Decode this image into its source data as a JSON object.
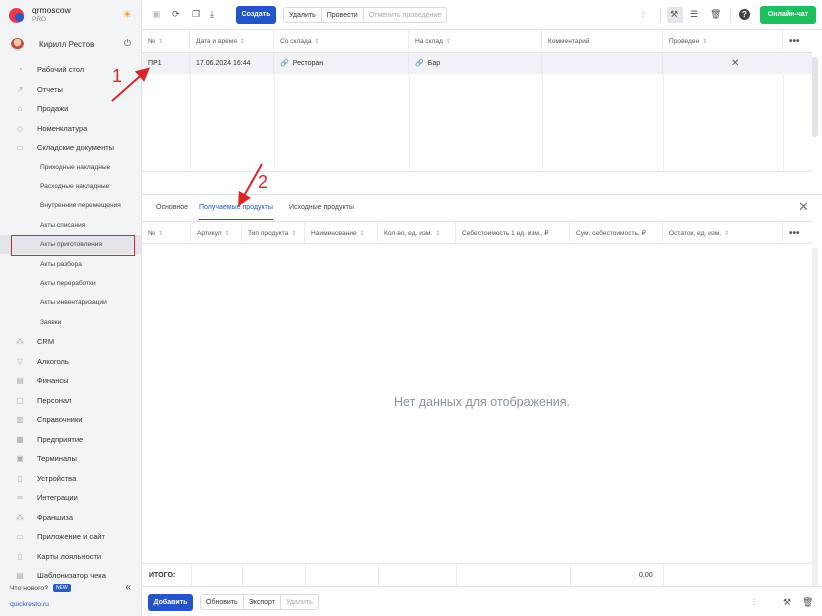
{
  "brand": {
    "name": "qrmoscow",
    "plan": "PRO"
  },
  "user": {
    "name": "Кирилл Рестов"
  },
  "nav": {
    "items_top": [
      {
        "label": "Рабочий стол",
        "icon": "dashboard-icon"
      },
      {
        "label": "Отчеты",
        "icon": "reports-icon"
      },
      {
        "label": "Продажи",
        "icon": "sales-icon"
      },
      {
        "label": "Номенклатура",
        "icon": "nomenclature-icon"
      },
      {
        "label": "Складские документы",
        "icon": "warehouse-icon"
      }
    ],
    "sub_items": [
      "Приходные накладные",
      "Расходные накладные",
      "Внутренние перемещения",
      "Акты списания",
      "Акты приготовления",
      "Акты разбора",
      "Акты переработки",
      "Акты инвентаризации",
      "Заявки"
    ],
    "active_sub": "Акты приготовления",
    "items_bottom": [
      {
        "label": "CRM",
        "icon": "crm-icon"
      },
      {
        "label": "Алкоголь",
        "icon": "alcohol-icon"
      },
      {
        "label": "Финансы",
        "icon": "finance-icon"
      },
      {
        "label": "Персонал",
        "icon": "staff-icon"
      },
      {
        "label": "Справочники",
        "icon": "directory-icon"
      },
      {
        "label": "Предприятие",
        "icon": "enterprise-icon"
      },
      {
        "label": "Терминалы",
        "icon": "terminal-icon"
      },
      {
        "label": "Устройства",
        "icon": "device-icon"
      },
      {
        "label": "Интеграции",
        "icon": "integration-icon"
      },
      {
        "label": "Франшиза",
        "icon": "franchise-icon"
      },
      {
        "label": "Приложение и сайт",
        "icon": "app-icon"
      },
      {
        "label": "Карты лояльности",
        "icon": "loyalty-icon"
      },
      {
        "label": "Шаблонизатор чека",
        "icon": "receipt-icon"
      }
    ],
    "whats_new": "Что нового?",
    "new_badge": "NEW",
    "site_link": "quickresto.ru"
  },
  "toolbar": {
    "create": "Создать",
    "delete": "Удалить",
    "post": "Провести",
    "unpost": "Отменить проведение",
    "online_chat": "Онлайн-чат"
  },
  "top_table": {
    "columns": [
      "№",
      "Дата и время",
      "Со склада",
      "На склад",
      "Комментарий",
      "Проведен"
    ],
    "rows": [
      {
        "num": "ПР1",
        "datetime": "17.06.2024 16:44",
        "from": "Ресторан",
        "to": "Бар",
        "comment": "",
        "posted": "✕"
      }
    ]
  },
  "detail": {
    "tabs": [
      "Основное",
      "Получаемые продукты",
      "Исходные продукты"
    ],
    "active_tab": "Получаемые продукты",
    "columns": [
      "№",
      "Артикул",
      "Тип продукта",
      "Наименование",
      "Кол-во, ед. изм.",
      "Себестоимость 1 ед. изм., ₽",
      "Сум. себестоимость, ₽",
      "Остаток, ед. изм."
    ],
    "empty_message": "Нет данных для отображения.",
    "totals_label": "ИТОГО:",
    "totals_value": "0,00"
  },
  "bottombar": {
    "add": "Добавить",
    "refresh": "Обновить",
    "export": "Экспорт",
    "delete": "Удалить"
  },
  "annotations": {
    "marker_1": "1",
    "marker_2": "2"
  },
  "colors": {
    "accent": "#2256c6",
    "green": "#1fbf60",
    "annotation": "#d9262d"
  }
}
